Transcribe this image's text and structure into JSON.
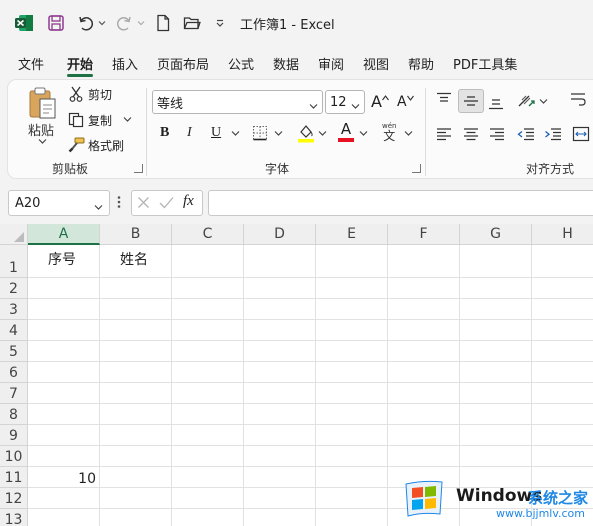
{
  "titlebar": {
    "title": "工作簿1  -  Excel",
    "app_icon": "excel-logo-icon",
    "icons": [
      "save-icon",
      "undo-icon",
      "redo-icon",
      "new-file-icon",
      "open-folder-icon",
      "customize-qat-icon"
    ]
  },
  "menu": {
    "tabs": [
      {
        "label": "文件",
        "active": false
      },
      {
        "label": "开始",
        "active": true
      },
      {
        "label": "插入",
        "active": false
      },
      {
        "label": "页面布局",
        "active": false
      },
      {
        "label": "公式",
        "active": false
      },
      {
        "label": "数据",
        "active": false
      },
      {
        "label": "审阅",
        "active": false
      },
      {
        "label": "视图",
        "active": false
      },
      {
        "label": "帮助",
        "active": false
      },
      {
        "label": "PDF工具集",
        "active": false
      }
    ]
  },
  "ribbon": {
    "clipboard": {
      "paste": "粘贴",
      "cut": "剪切",
      "copy": "复制",
      "format_painter": "格式刷",
      "group_label": "剪贴板"
    },
    "font": {
      "font_name": "等线",
      "font_size": "12",
      "bold": "B",
      "italic": "I",
      "underline": "U",
      "increase_size": "A",
      "decrease_size": "A",
      "font_color": "A",
      "phonetic_top": "wén",
      "phonetic_bottom": "文",
      "group_label": "字体",
      "fill_color": "#ffff00",
      "text_color": "#e81123"
    },
    "alignment": {
      "group_label": "对齐方式"
    }
  },
  "formula_bar": {
    "name_box": "A20",
    "fx": "fx",
    "formula": ""
  },
  "sheet": {
    "columns": [
      "A",
      "B",
      "C",
      "D",
      "E",
      "F",
      "G",
      "H"
    ],
    "rows": [
      "1",
      "2",
      "3",
      "4",
      "5",
      "6",
      "7",
      "8",
      "9",
      "10",
      "11",
      "12",
      "13"
    ],
    "selected_column": "A",
    "cells": {
      "A1": "序号",
      "B1": "姓名",
      "A11": "10"
    }
  },
  "watermark": {
    "brand": "Windows",
    "site_name": "系统之家",
    "url": "www.bjjmlv.com"
  },
  "colors": {
    "accent": "#1e7145",
    "windows_blue": "#1e88e5"
  }
}
